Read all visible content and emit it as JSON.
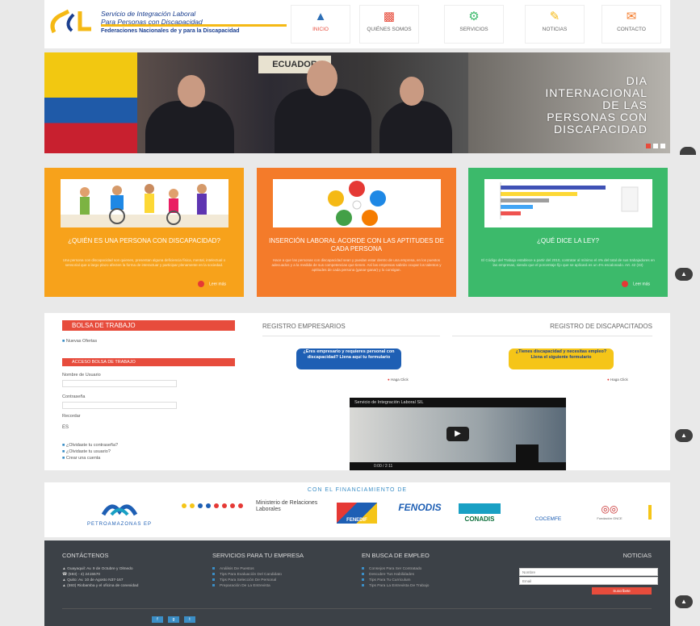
{
  "header": {
    "org_line1": "Servicio de Integración Laboral",
    "org_line1b": "Para Personas con Discapacidad",
    "org_line2": "Federaciones Nacionales de y para la Discapacidad",
    "nav": [
      {
        "label": "INICIO",
        "icon": "person-icon",
        "active": true
      },
      {
        "label": "QUIÉNES SOMOS",
        "icon": "sitemap-icon",
        "active": false
      },
      {
        "label": "SERVICIOS",
        "icon": "gears-icon",
        "active": false
      },
      {
        "label": "NOTICIAS",
        "icon": "edit-icon",
        "active": false
      },
      {
        "label": "CONTACTO",
        "icon": "envelope-icon",
        "active": false
      }
    ]
  },
  "hero": {
    "banner_text": "ECUADOR",
    "title": "DIA\nINTERNACIONAL\nDE LAS\nPERSONAS CON\nDISCAPACIDAD",
    "slide_index": 1,
    "slide_count": 3
  },
  "cards": [
    {
      "title": "¿QUIÉN ES UNA PERSONA CON DISCAPACIDAD?",
      "body": "Una persona con discapacidad son quienes, presentan alguna deficiencia física, mental, intelectual o sensorial que a largo plazo afecten la forma de interactuar y participar plenamente en la sociedad.",
      "more": "Leer más",
      "color": "#f7a21b"
    },
    {
      "title": "INSERCIÓN LABORAL ACORDE CON LAS APTITUDES DE CADA PERSONA",
      "body": "Hace a que las personas con discapacidad sean y puedan estar dentro de una empresa, en los puestos adecuados y a la medida de sus competencias que tienen. Así las empresas sabrán ocupar los talentos y aptitudes de cada persona (ganar-ganar) y lo consigan.",
      "more": "",
      "color": "#f47b2a"
    },
    {
      "title": "¿QUÉ DICE LA LEY?",
      "body": "El Código del Trabajo establece a partir del 2010, contratar al mínimo el 4% del total de sus trabajadores en las empresas, siendo que el porcentaje fijo que se aplicará es un 4% escalonado. Art. 42 (33)",
      "more": "Leer más",
      "color": "#3cba6b"
    }
  ],
  "bolsa": {
    "header": "BOLSA DE TRABAJO",
    "link_ofertas": "Nuevas Ofertas",
    "acceso_header": "ACCESO BOLSA DE TRABAJO",
    "user_label": "Nombre de Usuario",
    "password_label": "Contraseña",
    "remember_label": "Recordar",
    "links": [
      "¿Olvidaste tu contraseña?",
      "¿Olvidaste tu usuario?",
      "Crear una cuenta"
    ]
  },
  "registro_empresarios": {
    "title": "REGISTRO EMPRESARIOS",
    "cta": "¿Eres empresario y requieres personal con discapacidad? Llena aquí tu formulario",
    "more": "Haga Click"
  },
  "registro_discapacitados": {
    "title": "REGISTRO DE DISCAPACITADOS",
    "cta": "¿Tienes discapacidad y necesitas empleo? Llena el siguiente formulario",
    "more": "Haga Click"
  },
  "video": {
    "title": "Servicio de Integración Laboral SIL",
    "time": "0:00 / 2:11"
  },
  "funding": {
    "title": "CON EL FINANCIAMIENTO DE",
    "logos": [
      "PETROAMAZONAS EP",
      "Ministerio de Relaciones Laborales",
      "FENEDIF",
      "FENODIS",
      "CONADIS",
      "COCEMFE",
      "Fundación ONCE"
    ]
  },
  "footer": {
    "contact_title": "CONTÁCTENOS",
    "contact_lines": [
      "Guayaquil: Av. 9 de Octubre y Olmedo",
      "(593) - 4) 2415570",
      "Quito: Av. 10 de Agosto N37-167",
      "(593) Riobamba y el oficina de conexidad"
    ],
    "services_title": "SERVICIOS PARA TU EMPRESA",
    "services": [
      "Análisis De Puestos",
      "Tips Para Evaluación Del Candidato",
      "Tips Para Selección De Personal",
      "Preparación De La Entrevista"
    ],
    "jobs_title": "EN BUSCA DE EMPLEO",
    "jobs": [
      "Consejos Para Ser Contratado",
      "Descubre Tus Habilidades",
      "Tips Para Tu Curriculum",
      "Tips Para La Entrevista De Trabajo"
    ],
    "news_title": "NOTICIAS",
    "news_name_ph": "Nombre",
    "news_email_ph": "Email",
    "news_button": "Suscríbete"
  },
  "colors": {
    "red": "#e74c3c",
    "orange": "#f47b2a",
    "yellow": "#f7a21b",
    "green": "#3cba6b",
    "footer": "#3c4147"
  }
}
